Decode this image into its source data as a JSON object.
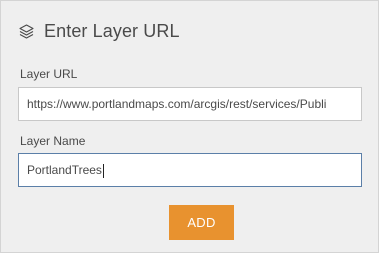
{
  "dialog": {
    "title": "Enter Layer URL",
    "icon": "layers-icon"
  },
  "form": {
    "url_label": "Layer URL",
    "url_value": "https://www.portlandmaps.com/arcgis/rest/services/Publi",
    "name_label": "Layer Name",
    "name_value": "PortlandTrees",
    "add_label": "ADD"
  },
  "colors": {
    "panel_bg": "#efefef",
    "accent_button": "#e8922f",
    "focused_border": "#5b7fa8"
  }
}
